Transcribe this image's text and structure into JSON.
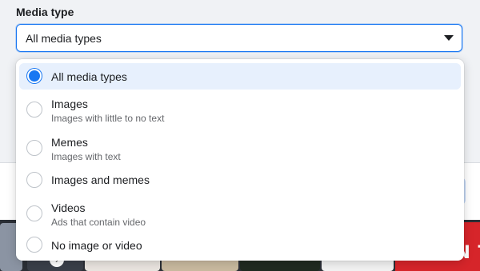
{
  "field": {
    "label": "Media type",
    "selected_value": "All media types",
    "caret_icon": "caret-down-icon"
  },
  "menu": {
    "options": [
      {
        "title": "All media types",
        "subtitle": "",
        "selected": true
      },
      {
        "title": "Images",
        "subtitle": "Images with little to no text",
        "selected": false
      },
      {
        "title": "Memes",
        "subtitle": "Images with text",
        "selected": false
      },
      {
        "title": "Images and memes",
        "subtitle": "",
        "selected": false
      },
      {
        "title": "Videos",
        "subtitle": "Ads that contain video",
        "selected": false
      },
      {
        "title": "No image or video",
        "subtitle": "",
        "selected": false
      }
    ]
  },
  "background": {
    "ad_thumbnail_text": "HO ON TH"
  },
  "colors": {
    "accent": "#1877f2",
    "selected_bg": "#e7f0fd",
    "text_primary": "#1c1e21",
    "text_secondary": "#65676b"
  }
}
